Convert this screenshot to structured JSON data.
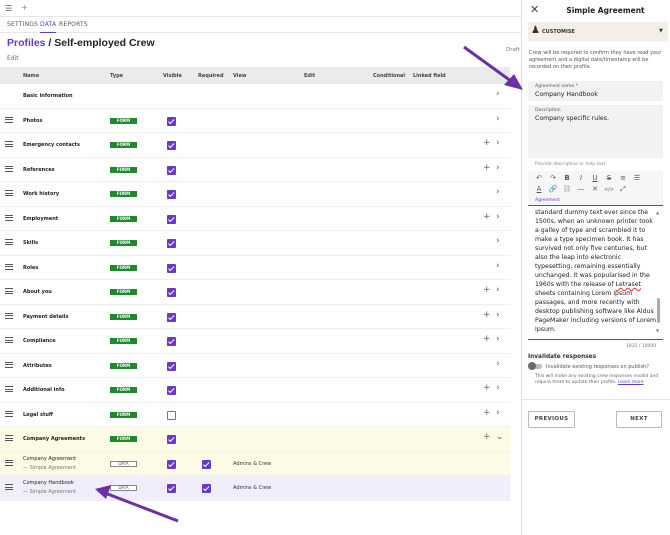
{
  "topbar": {
    "menu_icon": "hamburger-icon",
    "add_icon": "plus-icon"
  },
  "tabs": [
    {
      "label": "SETTINGS",
      "active": false
    },
    {
      "label": "DATA",
      "active": true
    },
    {
      "label": "REPORTS",
      "active": false
    }
  ],
  "header": {
    "breadcrumb": "Profiles",
    "separator": " / ",
    "title": "Self-employed Crew",
    "edit": "Edit",
    "status": "Draft"
  },
  "table": {
    "columns": [
      "Name",
      "Type",
      "Visible",
      "Required",
      "View",
      "Edit",
      "Conditional",
      "Linked field"
    ],
    "rows": [
      {
        "name": "Basic information",
        "sub": "",
        "type": "",
        "visible": null,
        "required": false,
        "view": "",
        "plus": false,
        "chevron": "›",
        "highlight": ""
      },
      {
        "name": "Photos",
        "sub": "",
        "type": "FORM",
        "visible": true,
        "required": false,
        "view": "",
        "plus": false,
        "chevron": "›",
        "highlight": ""
      },
      {
        "name": "Emergency contacts",
        "sub": "",
        "type": "FORM",
        "visible": true,
        "required": false,
        "view": "",
        "plus": true,
        "chevron": "›",
        "highlight": ""
      },
      {
        "name": "References",
        "sub": "",
        "type": "FORM",
        "visible": true,
        "required": false,
        "view": "",
        "plus": true,
        "chevron": "›",
        "highlight": ""
      },
      {
        "name": "Work history",
        "sub": "",
        "type": "FORM",
        "visible": true,
        "required": false,
        "view": "",
        "plus": false,
        "chevron": "›",
        "highlight": ""
      },
      {
        "name": "Employment",
        "sub": "",
        "type": "FORM",
        "visible": true,
        "required": false,
        "view": "",
        "plus": true,
        "chevron": "›",
        "highlight": ""
      },
      {
        "name": "Skills",
        "sub": "",
        "type": "FORM",
        "visible": true,
        "required": false,
        "view": "",
        "plus": false,
        "chevron": "›",
        "highlight": ""
      },
      {
        "name": "Roles",
        "sub": "",
        "type": "FORM",
        "visible": true,
        "required": false,
        "view": "",
        "plus": false,
        "chevron": "›",
        "highlight": ""
      },
      {
        "name": "About you",
        "sub": "",
        "type": "FORM",
        "visible": true,
        "required": false,
        "view": "",
        "plus": true,
        "chevron": "›",
        "highlight": ""
      },
      {
        "name": "Payment details",
        "sub": "",
        "type": "FORM",
        "visible": true,
        "required": false,
        "view": "",
        "plus": true,
        "chevron": "›",
        "highlight": ""
      },
      {
        "name": "Compliance",
        "sub": "",
        "type": "FORM",
        "visible": true,
        "required": false,
        "view": "",
        "plus": true,
        "chevron": "›",
        "highlight": ""
      },
      {
        "name": "Attributes",
        "sub": "",
        "type": "FORM",
        "visible": true,
        "required": false,
        "view": "",
        "plus": false,
        "chevron": "›",
        "highlight": ""
      },
      {
        "name": "Additional info",
        "sub": "",
        "type": "FORM",
        "visible": true,
        "required": false,
        "view": "",
        "plus": true,
        "chevron": "›",
        "highlight": ""
      },
      {
        "name": "Legal stuff",
        "sub": "",
        "type": "FORM",
        "visible": false,
        "required": false,
        "view": "",
        "plus": true,
        "chevron": "›",
        "highlight": ""
      },
      {
        "name": "Company Agreements",
        "sub": "",
        "type": "FORM",
        "visible": true,
        "required": false,
        "view": "",
        "plus": true,
        "chevron": "⌄",
        "highlight": "yellow"
      },
      {
        "name": "Company Agreement",
        "sub": "— Simple Agreement",
        "type": "DATA",
        "visible": true,
        "required": true,
        "view": "Admins & Crew",
        "plus": false,
        "chevron": "",
        "highlight": "yellow"
      },
      {
        "name": "Company Handbook",
        "sub": "— Simple Agreement",
        "type": "DATA",
        "visible": true,
        "required": true,
        "view": "Admins & Crew",
        "plus": false,
        "chevron": "",
        "highlight": "purple"
      }
    ]
  },
  "panel": {
    "title": "Simple Agreement",
    "close_icon": "close-icon",
    "customise_label": "CUSTOMISE",
    "description": "Crew will be required to confirm they have read your agreement and a digital date/timestamp will be recorded on their profile.",
    "agreement_name_label": "Agreement name *",
    "agreement_name_value": "Company Handbook",
    "description_label": "Description",
    "description_value": "Company specific rules.",
    "description_helper": "Provide descriptive or help text",
    "toolbar_row1": [
      "↶",
      "↷",
      "B",
      "I",
      "U",
      "S",
      "≡",
      "☰"
    ],
    "toolbar_row2": [
      "A",
      "🔗",
      "⛓",
      "—",
      "✕",
      "</>",
      "⤢"
    ],
    "agreement_label": "Agreement",
    "agreement_text_pre": "standard dummy text ever since the 1500s, when an unknown printer took a galley of type and scrambled it to make a type specimen book. It has survived not only five centuries, but also the leap into electronic typesetting, remaining essentially unchanged. It was popularised in the 1960s with the release of ",
    "agreement_text_squiggle": "Letraset",
    "agreement_text_post": " sheets containing Lorem Ipsum passages, and more recently with desktop publishing software like Aldus PageMaker including versions of Lorem Ipsum.",
    "counter": "1835 / 10000",
    "invalidate_title": "Invalidate responses",
    "invalidate_label": "Invalidate existing responses on publish?",
    "invalidate_note": "This will make any existing crew responses invalid and require them to update their profile.",
    "learn_more": "Learn more",
    "previous_label": "PREVIOUS",
    "next_label": "NEXT"
  },
  "colors": {
    "accent": "#6a39c9",
    "form_badge": "#1e8a2b",
    "arrow": "#6b2fa8"
  }
}
